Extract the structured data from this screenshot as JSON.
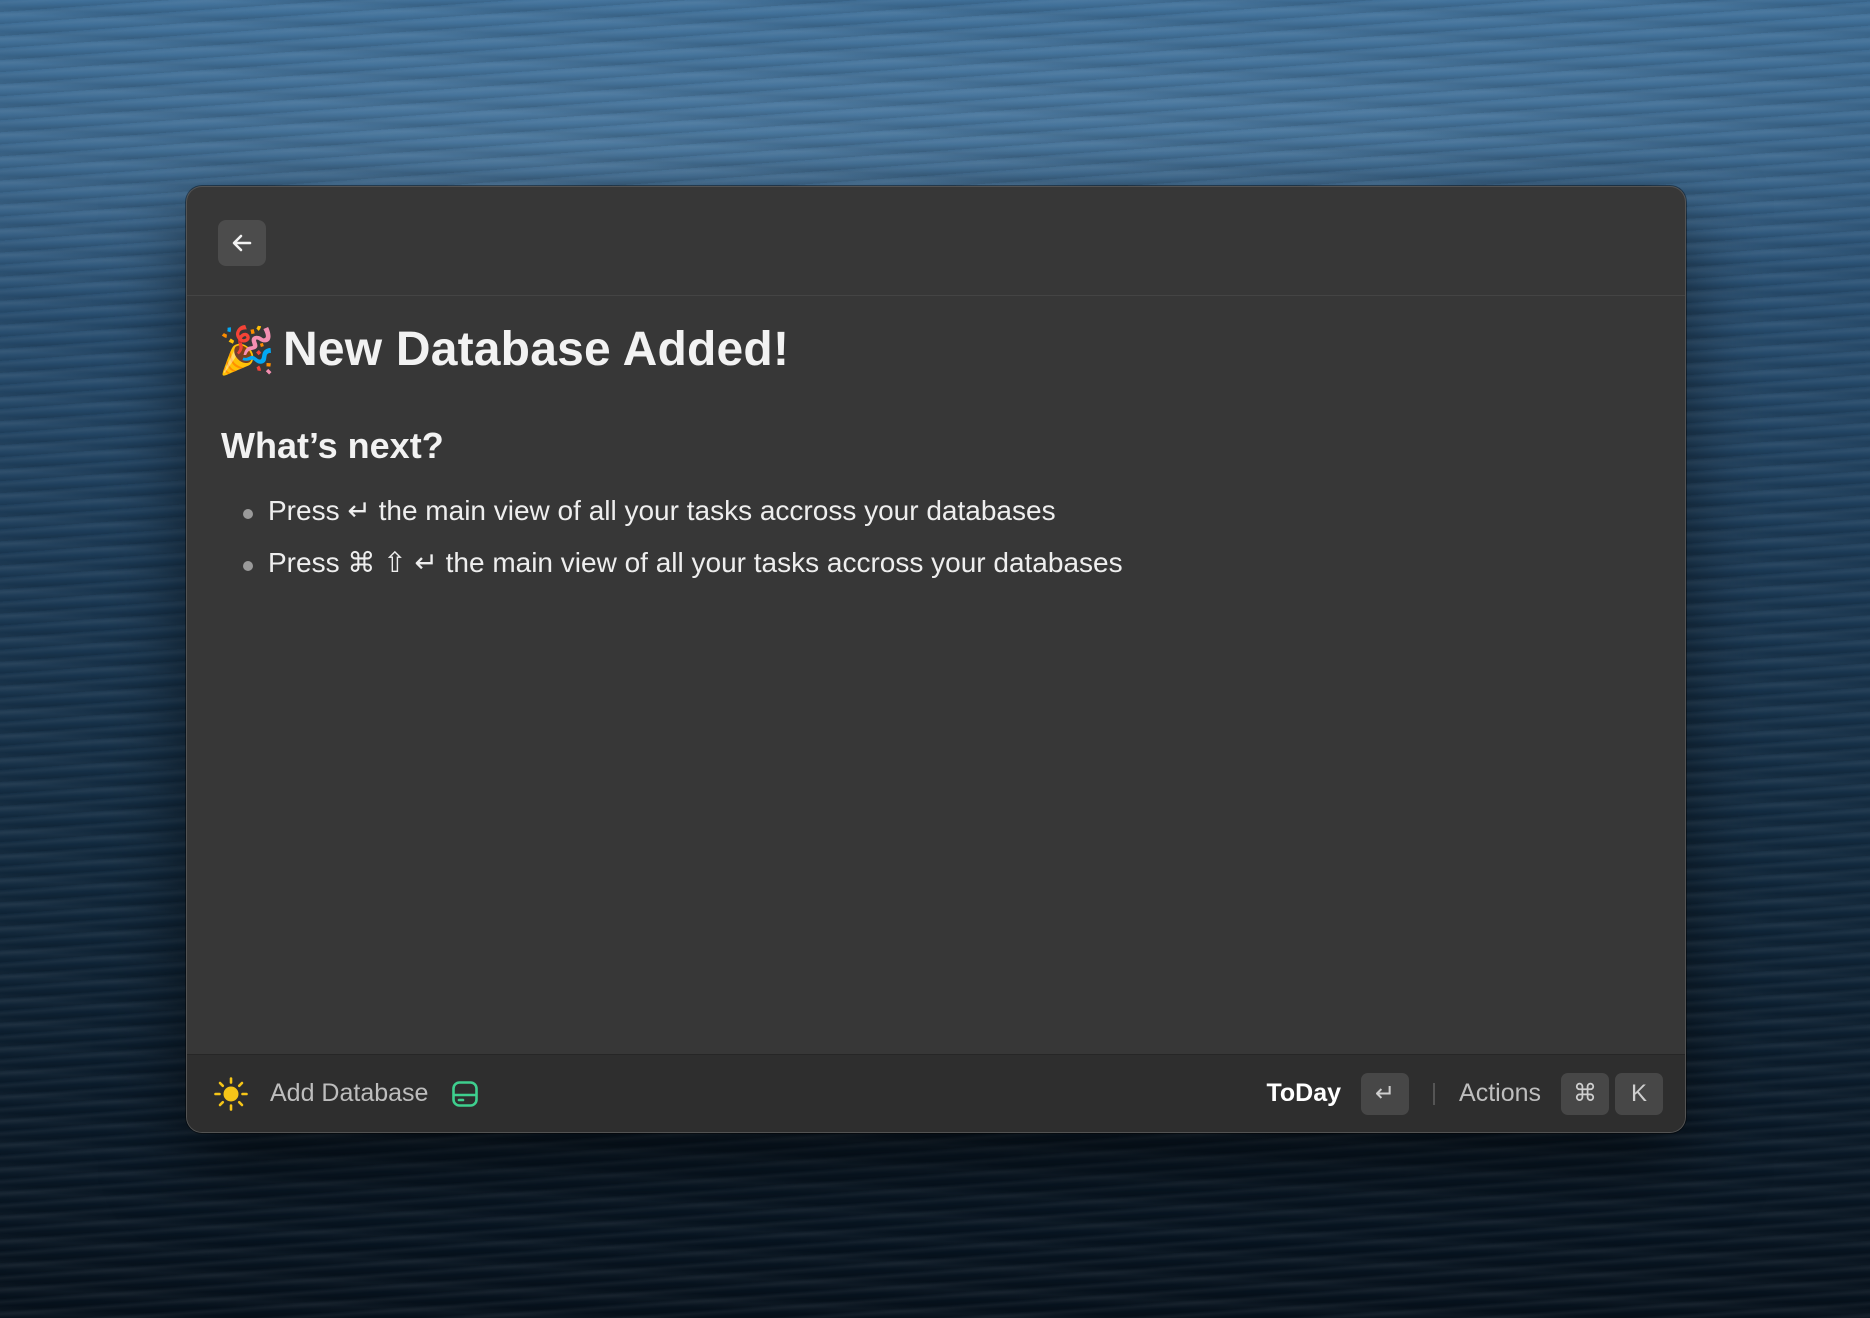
{
  "window": {
    "back_icon": "arrow-left-icon"
  },
  "content": {
    "emoji": "🎉",
    "title": "New Database Added!",
    "subtitle": "What’s next?",
    "items": [
      "Press ↵ the main view of all your tasks accross your databases",
      "Press ⌘ ⇧ ↵ the main view of all your tasks accross your databases"
    ]
  },
  "footer": {
    "left_icon": "sun-icon",
    "left_label": "Add Database",
    "database_icon": "database-icon",
    "database_icon_color": "#3ecf8e",
    "primary_action": "ToDay",
    "primary_shortcut": "↵",
    "actions_label": "Actions",
    "actions_shortcut": [
      "⌘",
      "K"
    ]
  },
  "colors": {
    "window_bg": "#373737",
    "footer_bg": "#2e2e2e",
    "sun": "#f5c518"
  }
}
